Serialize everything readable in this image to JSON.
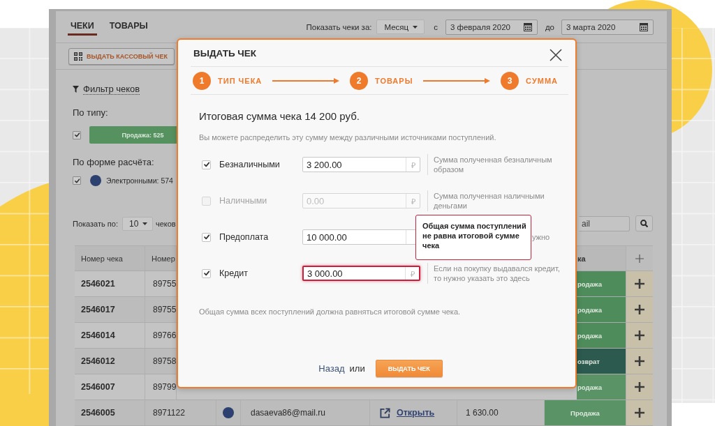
{
  "app": {
    "tabs": [
      {
        "label": "ЧЕКИ",
        "selected": true
      },
      {
        "label": "ТОВАРЫ",
        "selected": false
      }
    ],
    "period": {
      "label": "Показать чеки за:",
      "value": "Месяц",
      "from_label": "с",
      "from_date": "3 февраля 2020",
      "to_label": "до",
      "to_date": "3 марта 2020"
    },
    "issue_button": "ВЫДАТЬ КАССОВЫЙ ЧЕК",
    "filter": {
      "title": "Фильтр чеков",
      "by_type": {
        "label": "По типу:",
        "items": [
          {
            "label": "Продажа: 525",
            "checked": true
          }
        ]
      },
      "by_payment": {
        "label": "По форме расчёта:",
        "items": [
          {
            "label": "Электронными: 574",
            "checked": true
          }
        ]
      }
    },
    "page_size": {
      "label": "Показать по:",
      "value": "10",
      "suffix": "чеков"
    },
    "search": {
      "placeholder": "ail"
    },
    "table": {
      "columns": [
        "Номер чека",
        "Номер",
        "ка"
      ],
      "rows": [
        {
          "kind": "partial",
          "receipt_number": "2546021",
          "column_2": "89755",
          "column_7": {
            "label": "родажа",
            "color": "#4f8c5b"
          }
        },
        {
          "kind": "partial",
          "receipt_number": "2546017",
          "column_2": "89755",
          "column_7": {
            "label": "родажа",
            "color": "#4f8c5b"
          }
        },
        {
          "kind": "partial",
          "receipt_number": "2546014",
          "column_2": "89766",
          "column_7": {
            "label": "родажа",
            "color": "#4f8c5b"
          }
        },
        {
          "kind": "partial",
          "receipt_number": "2546012",
          "column_2": "89758",
          "column_7": {
            "label": "озврат",
            "color": "#2c5a4e"
          }
        },
        {
          "kind": "partial",
          "receipt_number": "2546007",
          "column_2": "89799",
          "column_7": {
            "label": "родажа",
            "color": "#5a9466"
          }
        },
        {
          "kind": "full",
          "receipt_number": "2546005",
          "column_2": "8971122",
          "column_4": "dasaeva86@mail.ru",
          "column_5": "Открыть",
          "column_6": "1 630.00",
          "column_7": {
            "label": "Продажа",
            "color": "#5a9466"
          }
        }
      ]
    }
  },
  "modal": {
    "title": "ВЫДАТЬ ЧЕК",
    "steps": [
      {
        "number": "1",
        "label": "ТИП ЧЕКА"
      },
      {
        "number": "2",
        "label": "ТОВАРЫ"
      },
      {
        "number": "3",
        "label": "СУММА"
      }
    ],
    "total": "Итоговая сумма чека 14 200 руб.",
    "hint": "Вы можете распределить эту сумму между различными источниками поступлений.",
    "sources": [
      {
        "label": "Безналичными",
        "checked": true,
        "disabled": false,
        "value": "3 200.00",
        "currency": "₽",
        "error": false,
        "help": "Сумма полученная безналичным образом"
      },
      {
        "label": "Наличными",
        "checked": false,
        "disabled": true,
        "value": "0.00",
        "currency": "₽",
        "error": false,
        "help": "Сумма полученная наличными деньгами"
      },
      {
        "label": "Предоплата",
        "checked": true,
        "disabled": false,
        "value": "10 000.00",
        "error": false,
        "help": "ужно",
        "tooltip": "Общая сумма поступлений не равна итоговой сумме чека"
      },
      {
        "label": "Кредит",
        "checked": true,
        "disabled": false,
        "value": "3 000.00",
        "currency": "₽",
        "error": true,
        "help": "Если на покупку выдавался кредит, то нужно указать это здесь"
      }
    ],
    "note": "Общая сумма всех поступлений должна равняться итоговой сумме чека.",
    "back_link": "Назад",
    "or": "или",
    "submit": "ВЫДАТЬ ЧЕК"
  }
}
